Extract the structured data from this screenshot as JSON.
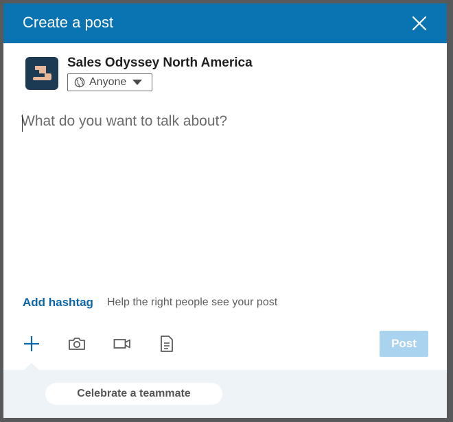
{
  "dialog": {
    "title": "Create a post"
  },
  "author": {
    "name": "Sales Odyssey North America",
    "visibility": "Anyone"
  },
  "composer": {
    "placeholder": "What do you want to talk about?"
  },
  "hashtag": {
    "button_label": "Add hashtag",
    "help_text": "Help the right people see your post"
  },
  "toolbar": {
    "tools": [
      {
        "icon": "plus-icon"
      },
      {
        "icon": "camera-icon"
      },
      {
        "icon": "video-icon"
      },
      {
        "icon": "document-icon"
      }
    ],
    "post_label": "Post"
  },
  "suggestions": {
    "celebrate_label": "Celebrate a teammate"
  },
  "colors": {
    "header": "#0a73b1",
    "link": "#0a66a8",
    "post_disabled": "#a9d3ee",
    "suggest_bg": "#eef3f8",
    "avatar_bg": "#1d3a55"
  }
}
